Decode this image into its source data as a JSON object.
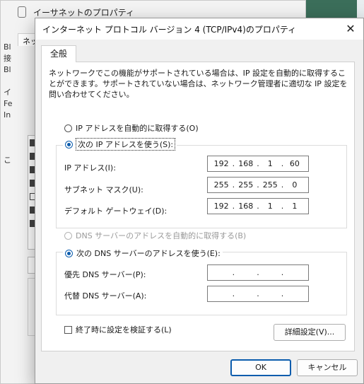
{
  "background_window": {
    "title": "イーサネットのプロパティ",
    "tab": "ネッ",
    "side_lines": [
      "Bl",
      "接",
      "Bl",
      "",
      "イ",
      "Fe",
      "In",
      "",
      "",
      "",
      "こ"
    ]
  },
  "dialog": {
    "title": "インターネット プロトコル バージョン 4 (TCP/IPv4)のプロパティ",
    "close_glyph": "✕",
    "tab_label": "全般",
    "description": "ネットワークでこの機能がサポートされている場合は、IP 設定を自動的に取得することができます。サポートされていない場合は、ネットワーク管理者に適切な IP 設定を問い合わせてください。",
    "ip_auto_label": "IP アドレスを自動的に取得する(O)",
    "ip_manual_label": "次の IP アドレスを使う(S):",
    "ip_address_label": "IP アドレス(I):",
    "ip_address": [
      "192",
      "168",
      "1",
      "60"
    ],
    "subnet_label": "サブネット マスク(U):",
    "subnet": [
      "255",
      "255",
      "255",
      "0"
    ],
    "gateway_label": "デフォルト ゲートウェイ(D):",
    "gateway": [
      "192",
      "168",
      "1",
      "1"
    ],
    "dns_auto_label": "DNS サーバーのアドレスを自動的に取得する(B)",
    "dns_manual_label": "次の DNS サーバーのアドレスを使う(E):",
    "preferred_dns_label": "優先 DNS サーバー(P):",
    "preferred_dns": [
      "",
      "",
      "",
      ""
    ],
    "alternate_dns_label": "代替 DNS サーバー(A):",
    "alternate_dns": [
      "",
      "",
      "",
      ""
    ],
    "validate_label": "終了時に設定を検証する(L)",
    "advanced_button": "詳細設定(V)...",
    "ok_button": "OK",
    "cancel_button": "キャンセル",
    "accent_color": "#0b5cad"
  }
}
